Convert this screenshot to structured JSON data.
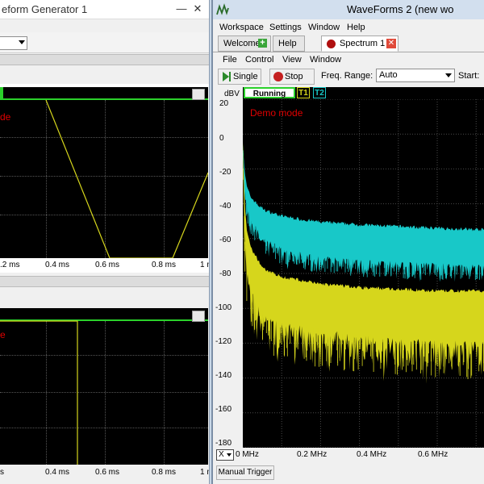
{
  "left_window": {
    "title": "eform Generator 1",
    "combo_value": "",
    "top_plot": {
      "demo_text": "de",
      "x_ticks": [
        ".2 ms",
        "0.4 ms",
        "0.6 ms",
        "0.8 ms",
        "1 m"
      ]
    },
    "bottom_plot": {
      "demo_text": "e",
      "x_ticks": [
        "s",
        "0.4 ms",
        "0.6 ms",
        "0.8 ms",
        "1 m"
      ]
    }
  },
  "right_window": {
    "title": "WaveForms 2 (new wo",
    "menu": [
      "Workspace",
      "Settings",
      "Window",
      "Help"
    ],
    "tabs": {
      "welcome": "Welcome",
      "help": "Help",
      "spectrum": "Spectrum 1"
    },
    "submenu": [
      "File",
      "Control",
      "View",
      "Window"
    ],
    "toolbar": {
      "single": "Single",
      "stop": "Stop",
      "freq_range_label": "Freq. Range:",
      "freq_range_value": "Auto",
      "start_label": "Start:"
    },
    "status": {
      "running": "Running",
      "t1": "T1",
      "t2": "T2"
    },
    "y_unit": "dBV",
    "demo_text": "Demo mode",
    "x_selector": "X",
    "manual_trigger": "Manual Trigger"
  },
  "chart_data": {
    "type": "line",
    "ylabel": "dBV",
    "ylim": [
      -180,
      20
    ],
    "y_ticks": [
      "20",
      "0",
      "-20",
      "-40",
      "-60",
      "-80",
      "-100",
      "-120",
      "-140",
      "-160",
      "-180"
    ],
    "x_ticks": [
      "0 MHz",
      "0.2 MHz",
      "0.4 MHz",
      "0.6 MHz"
    ],
    "xlim": [
      0,
      0.78
    ],
    "series": [
      {
        "color": "#18c8c8",
        "x": [
          0,
          0.005,
          0.01,
          0.02,
          0.04,
          0.06,
          0.1,
          0.15,
          0.2,
          0.3,
          0.4,
          0.5,
          0.6,
          0.7,
          0.78
        ],
        "upper": [
          -5,
          -22,
          -30,
          -36,
          -41,
          -44,
          -47,
          -49,
          -50.5,
          -52,
          -53,
          -54,
          -54.8,
          -55.5,
          -56
        ],
        "lower": [
          -5,
          -30,
          -40,
          -48,
          -55,
          -60,
          -65,
          -68,
          -70,
          -72,
          -73,
          -74,
          -75,
          -76,
          -76
        ]
      },
      {
        "color": "#d6d61c",
        "x": [
          0,
          0.005,
          0.01,
          0.02,
          0.04,
          0.06,
          0.1,
          0.15,
          0.2,
          0.3,
          0.4,
          0.5,
          0.6,
          0.7,
          0.78
        ],
        "upper": [
          -5,
          -40,
          -55,
          -65,
          -73,
          -78,
          -82,
          -84,
          -86,
          -88,
          -89,
          -90,
          -90,
          -91,
          -91
        ],
        "lower": [
          -5,
          -60,
          -75,
          -88,
          -98,
          -104,
          -108,
          -110,
          -112,
          -115,
          -117,
          -118,
          -119,
          -120,
          -120
        ]
      }
    ]
  },
  "colors": {
    "accent_green": "#2bd12b",
    "trace_cyan": "#18c8c8",
    "trace_yellow": "#d6d61c",
    "demo_red": "#e00000"
  }
}
